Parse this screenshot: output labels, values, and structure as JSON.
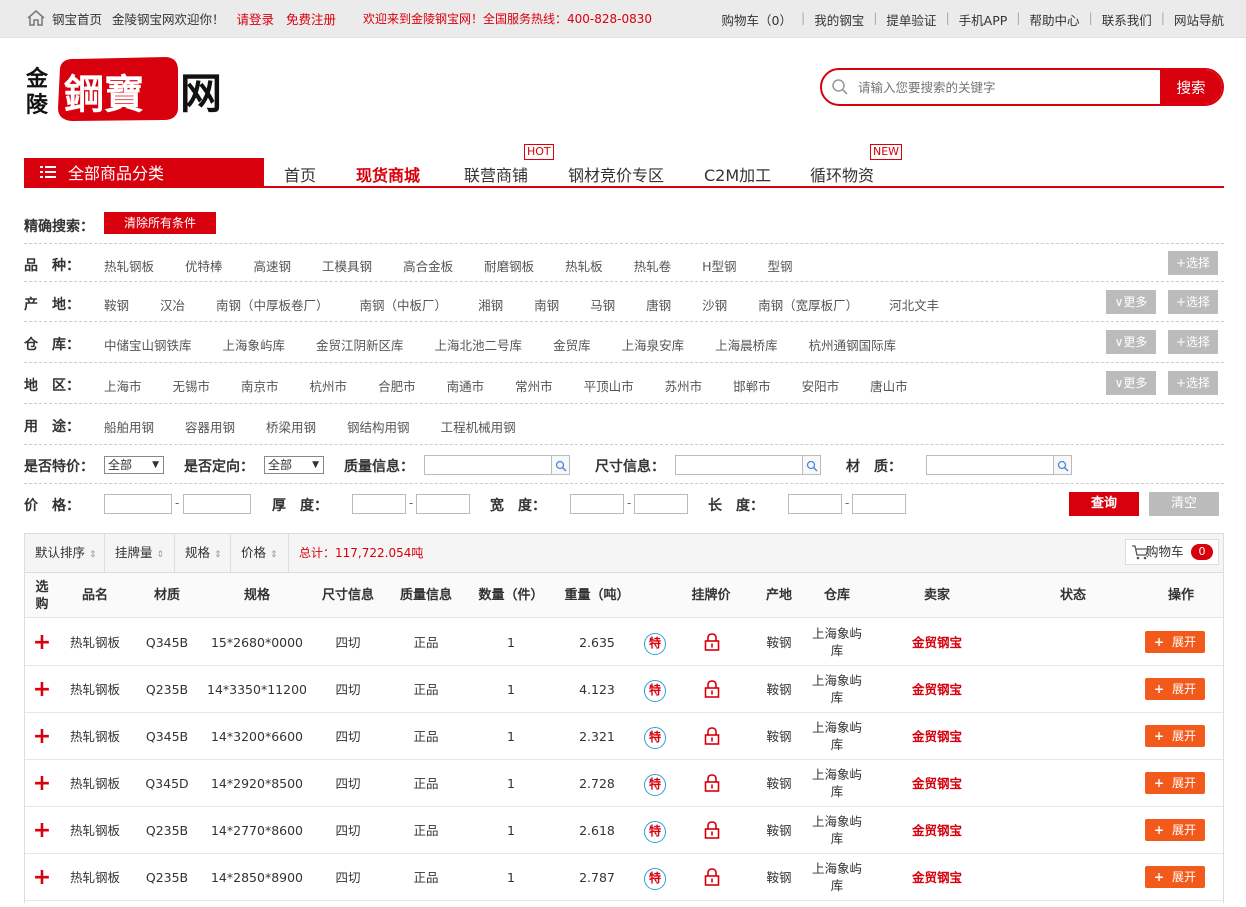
{
  "topbar": {
    "home_link": "钢宝首页",
    "welcome": "金陵钢宝网欢迎你！",
    "login": "请登录",
    "register": "免费注册",
    "promo": "欢迎来到金陵钢宝网！全国服务热线：400-828-0830",
    "links": [
      "购物车（0）",
      "我的钢宝",
      "提单验证",
      "手机APP",
      "帮助中心",
      "联系我们",
      "网站导航"
    ]
  },
  "logo": {
    "left_chars": [
      "金",
      "陵"
    ],
    "main": "鋼寶",
    "suffix": "网"
  },
  "search": {
    "placeholder": "请输入您要搜索的关键字",
    "button": "搜索"
  },
  "nav": {
    "all_categories": "全部商品分类",
    "items": [
      {
        "label": "首页",
        "tag": ""
      },
      {
        "label": "现货商城",
        "tag": ""
      },
      {
        "label": "联营商铺",
        "tag": "HOT"
      },
      {
        "label": "钢材竞价专区",
        "tag": ""
      },
      {
        "label": "C2M加工",
        "tag": ""
      },
      {
        "label": "循环物资",
        "tag": "NEW"
      }
    ]
  },
  "filters": {
    "title": "精确搜索：",
    "clear_all": "清除所有条件",
    "rows": [
      {
        "label": "品　种：",
        "options": [
          "热轧钢板",
          "优特棒",
          "高速钢",
          "工模具钢",
          "高合金板",
          "耐磨钢板",
          "热轧板",
          "热轧卷",
          "H型钢",
          "型钢"
        ],
        "more": "",
        "select": "+选择"
      },
      {
        "label": "产　地：",
        "options": [
          "鞍钢",
          "汉冶",
          "南钢（中厚板卷厂）",
          "南钢（中板厂）",
          "湘钢",
          "南钢",
          "马钢",
          "唐钢",
          "沙钢",
          "南钢（宽厚板厂）",
          "河北文丰"
        ],
        "more": "∨更多",
        "select": "+选择"
      },
      {
        "label": "仓　库：",
        "options": [
          "中储宝山钢铁库",
          "上海象屿库",
          "金贸江阴新区库",
          "上海北池二号库",
          "金贸库",
          "上海泉安库",
          "上海晨桥库",
          "杭州通钢国际库"
        ],
        "more": "∨更多",
        "select": "+选择"
      },
      {
        "label": "地　区：",
        "options": [
          "上海市",
          "无锡市",
          "南京市",
          "杭州市",
          "合肥市",
          "南通市",
          "常州市",
          "平顶山市",
          "苏州市",
          "邯郸市",
          "安阳市",
          "唐山市"
        ],
        "more": "∨更多",
        "select": "+选择"
      },
      {
        "label": "用　途：",
        "options": [
          "船舶用钢",
          "容器用钢",
          "桥梁用钢",
          "钢结构用钢",
          "工程机械用钢"
        ],
        "more": "",
        "select": ""
      }
    ],
    "special_label": "是否特价：",
    "special_value": "全部",
    "directional_label": "是否定向：",
    "directional_value": "全部",
    "quality_label": "质量信息：",
    "size_label": "尺寸信息：",
    "material_label": "材　质：",
    "price_label": "价　格：",
    "thickness_label": "厚　度：",
    "width_label": "宽　度：",
    "length_label": "长　度：",
    "dash": "-",
    "query": "查询",
    "reset": "清空"
  },
  "sortbar": {
    "items": [
      "默认排序",
      "挂牌量",
      "规格",
      "价格"
    ],
    "total": "总计：117,722.054吨",
    "cart": "购物车",
    "cart_count": "0"
  },
  "table": {
    "headers": [
      "选购",
      "品名",
      "材质",
      "规格",
      "尺寸信息",
      "质量信息",
      "数量（件）",
      "重量（吨）",
      "",
      "挂牌价",
      "产地",
      "仓库",
      "卖家",
      "状态",
      "操作"
    ],
    "rows": [
      {
        "name": "热轧钢板",
        "material": "Q345B",
        "spec": "15*2680*0000",
        "size": "四切",
        "quality": "正品",
        "qty": "1",
        "weight": "2.635",
        "special": "特",
        "origin": "鞍钢",
        "warehouse": "上海象屿库",
        "seller": "金贸钢宝",
        "action": "展开"
      },
      {
        "name": "热轧钢板",
        "material": "Q235B",
        "spec": "14*3350*11200",
        "size": "四切",
        "quality": "正品",
        "qty": "1",
        "weight": "4.123",
        "special": "特",
        "origin": "鞍钢",
        "warehouse": "上海象屿库",
        "seller": "金贸钢宝",
        "action": "展开"
      },
      {
        "name": "热轧钢板",
        "material": "Q345B",
        "spec": "14*3200*6600",
        "size": "四切",
        "quality": "正品",
        "qty": "1",
        "weight": "2.321",
        "special": "特",
        "origin": "鞍钢",
        "warehouse": "上海象屿库",
        "seller": "金贸钢宝",
        "action": "展开"
      },
      {
        "name": "热轧钢板",
        "material": "Q345D",
        "spec": "14*2920*8500",
        "size": "四切",
        "quality": "正品",
        "qty": "1",
        "weight": "2.728",
        "special": "特",
        "origin": "鞍钢",
        "warehouse": "上海象屿库",
        "seller": "金贸钢宝",
        "action": "展开"
      },
      {
        "name": "热轧钢板",
        "material": "Q235B",
        "spec": "14*2770*8600",
        "size": "四切",
        "quality": "正品",
        "qty": "1",
        "weight": "2.618",
        "special": "特",
        "origin": "鞍钢",
        "warehouse": "上海象屿库",
        "seller": "金贸钢宝",
        "action": "展开"
      },
      {
        "name": "热轧钢板",
        "material": "Q235B",
        "spec": "14*2850*8900",
        "size": "四切",
        "quality": "正品",
        "qty": "1",
        "weight": "2.787",
        "special": "特",
        "origin": "鞍钢",
        "warehouse": "上海象屿库",
        "seller": "金贸钢宝",
        "action": "展开"
      }
    ]
  },
  "colors": {
    "brand_red": "#d8000c",
    "action_orange": "#f25a1c",
    "special_ring": "#2aa0d8"
  }
}
